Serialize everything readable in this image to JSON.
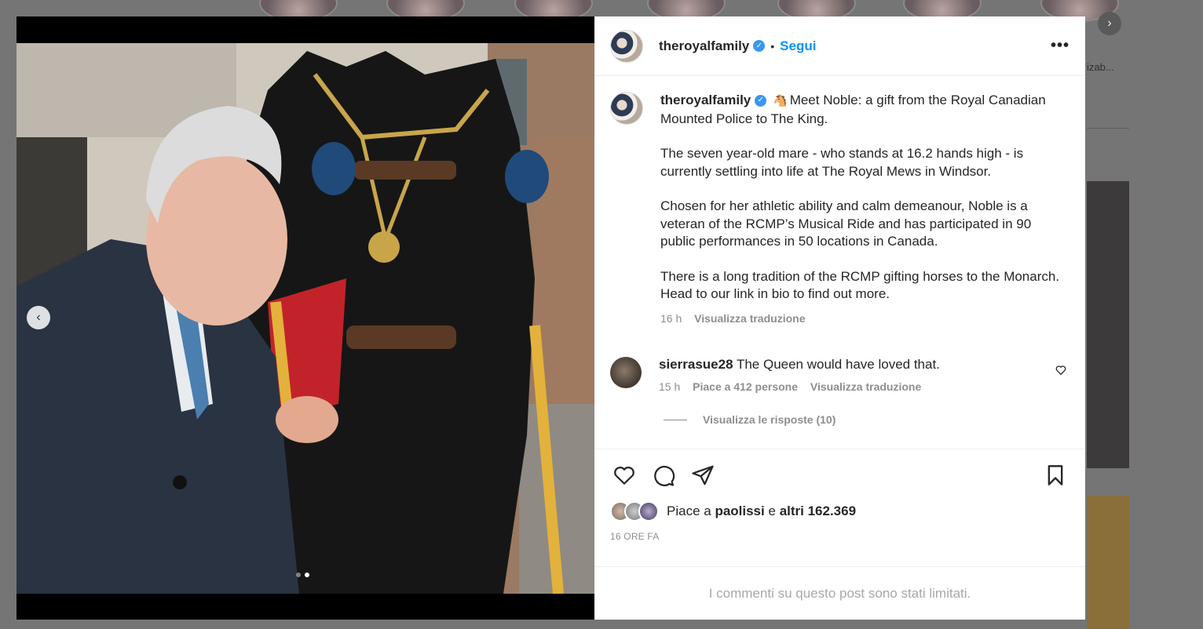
{
  "background": {
    "side_label": "izab...",
    "next_icon": "chevron-right-icon"
  },
  "post": {
    "username": "theroyalfamily",
    "separator": "•",
    "follow_label": "Segui",
    "more_icon": "•••",
    "caption": {
      "username": "theroyalfamily",
      "emoji": "🐴",
      "paragraphs": [
        "Meet Noble: a gift from the Royal Canadian Mounted Police to The King.",
        "The seven year-old mare - who stands at 16.2 hands high - is currently settling into life at The Royal Mews in Windsor.",
        "Chosen for her athletic ability and calm demeanour, Noble is a veteran of the RCMP’s Musical Ride and has participated in 90 public performances in 50 locations in Canada.",
        "There is a long tradition of the RCMP gifting horses to the Monarch. Head to our link in bio to find out more."
      ],
      "time": "16 h",
      "translate_label": "Visualizza traduzione"
    },
    "comment": {
      "username": "sierrasue28",
      "text": "The Queen would have loved that.",
      "time": "15 h",
      "likes_label": "Piace a 412 persone",
      "translate_label": "Visualizza traduzione",
      "replies_label": "Visualizza le risposte (10)"
    },
    "likes": {
      "prefix": "Piace a",
      "user": "paolissi",
      "conj": "e",
      "others": "altri 162.369"
    },
    "time_ago": "16 ORE FA",
    "restricted_text": "I commenti su questo post sono stati limitati."
  },
  "media": {
    "slide_count": 2,
    "active_slide": 2
  },
  "colors": {
    "link_blue": "#0095f6",
    "verified_blue": "#3897f0",
    "text_primary": "#262626",
    "text_secondary": "#8e8e8e"
  }
}
